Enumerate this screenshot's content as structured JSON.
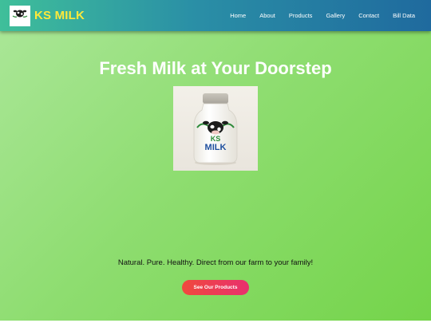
{
  "header": {
    "brand_name": "KS MILK",
    "logo_icon": "cow-logo-icon",
    "logo_text": "KS MILK",
    "nav": [
      {
        "label": "Home"
      },
      {
        "label": "About"
      },
      {
        "label": "Products"
      },
      {
        "label": "Gallery"
      },
      {
        "label": "Contact"
      },
      {
        "label": "Bill Data"
      }
    ]
  },
  "hero": {
    "title": "Fresh Milk at Your Doorstep",
    "image_icon": "milk-bottle-image",
    "bottle_label": "KS MILK",
    "tagline": "Natural. Pure. Healthy. Direct from our farm to your family!",
    "cta_label": "See Our Products"
  },
  "colors": {
    "brand_yellow": "#ffe93a",
    "navbar_start": "#3fbf9a",
    "navbar_end": "#1f6a9e",
    "hero_start": "#a9e696",
    "hero_end": "#74d44a",
    "cta_start": "#f0493d",
    "cta_end": "#e8306e"
  }
}
